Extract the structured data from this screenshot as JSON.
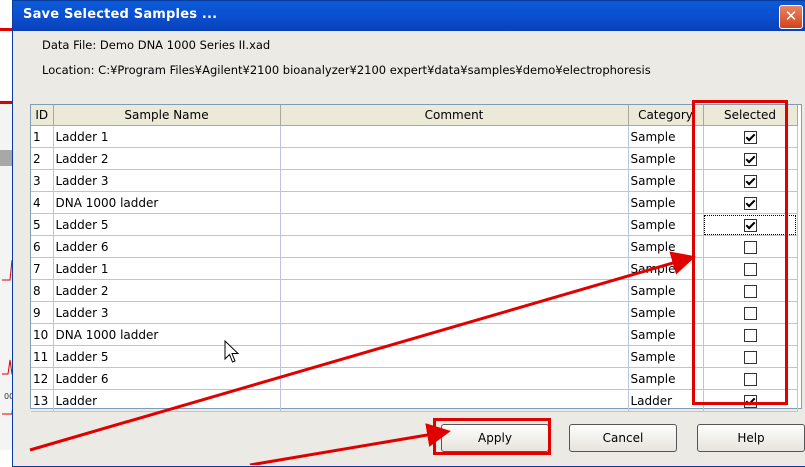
{
  "dialog": {
    "title": "Save Selected Samples ...",
    "close_label": "✕",
    "data_file_label": "Data File: Demo DNA 1000 Series II.xad",
    "location_label": "Location:  C:¥Program Files¥Agilent¥2100 bioanalyzer¥2100 expert¥data¥samples¥demo¥electrophoresis"
  },
  "table": {
    "headers": [
      "ID",
      "Sample Name",
      "Comment",
      "Category",
      "Selected"
    ],
    "rows": [
      {
        "id": "1",
        "name": "Ladder 1",
        "comment": "",
        "category": "Sample",
        "selected": true
      },
      {
        "id": "2",
        "name": "Ladder 2",
        "comment": "",
        "category": "Sample",
        "selected": true
      },
      {
        "id": "3",
        "name": "Ladder 3",
        "comment": "",
        "category": "Sample",
        "selected": true
      },
      {
        "id": "4",
        "name": "DNA 1000 ladder",
        "comment": "",
        "category": "Sample",
        "selected": true
      },
      {
        "id": "5",
        "name": "Ladder 5",
        "comment": "",
        "category": "Sample",
        "selected": true
      },
      {
        "id": "6",
        "name": "Ladder 6",
        "comment": "",
        "category": "Sample",
        "selected": false
      },
      {
        "id": "7",
        "name": "Ladder 1",
        "comment": "",
        "category": "Sample",
        "selected": false
      },
      {
        "id": "8",
        "name": "Ladder 2",
        "comment": "",
        "category": "Sample",
        "selected": false
      },
      {
        "id": "9",
        "name": "Ladder 3",
        "comment": "",
        "category": "Sample",
        "selected": false
      },
      {
        "id": "10",
        "name": "DNA 1000 ladder",
        "comment": "",
        "category": "Sample",
        "selected": false
      },
      {
        "id": "11",
        "name": "Ladder 5",
        "comment": "",
        "category": "Sample",
        "selected": false
      },
      {
        "id": "12",
        "name": "Ladder 6",
        "comment": "",
        "category": "Sample",
        "selected": false
      },
      {
        "id": "13",
        "name": "Ladder",
        "comment": "",
        "category": "Ladder",
        "selected": true
      }
    ]
  },
  "buttons": {
    "apply": "Apply",
    "cancel": "Cancel",
    "help": "Help"
  },
  "background_app": {
    "tick_label": "00"
  },
  "colors": {
    "title_bar": "#0b4fd0",
    "highlight": "#e00000",
    "dialog_bg": "#eceae4"
  }
}
